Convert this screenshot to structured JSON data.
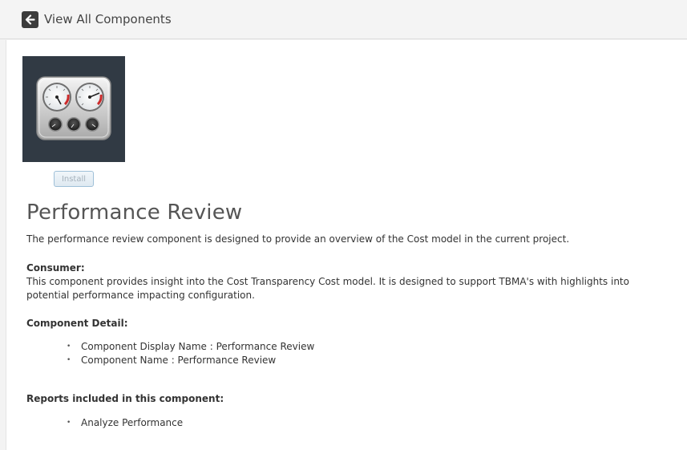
{
  "header": {
    "back_label": "View All Components"
  },
  "component": {
    "image_icon": "dashboard-gauges-icon",
    "install_label": "Install",
    "title": "Performance Review",
    "description": "The performance review component is designed to provide an overview of the Cost model in the current project.",
    "consumer_heading": "Consumer:",
    "consumer_text": "This component provides insight into the Cost Transparency Cost model.  It is designed to support TBMA's with highlights into potential performance impacting configuration.",
    "detail_heading": "Component Detail:",
    "details": [
      "Component Display Name : Performance Review",
      "Component Name : Performance Review"
    ],
    "reports_heading": "Reports included in this component:",
    "reports": [
      "Analyze Performance"
    ]
  },
  "colors": {
    "thumbnail_bg": "#313a44",
    "page_bg": "#f3f3f3",
    "panel_bg": "#ffffff"
  }
}
